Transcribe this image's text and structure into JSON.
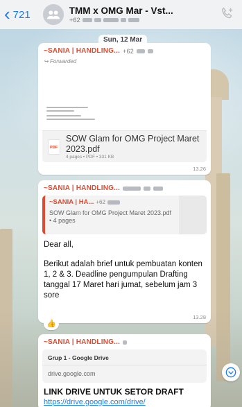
{
  "header": {
    "back_count": "721",
    "title": "TMM x OMG Mar - Vst...",
    "subtitle_prefix": "+62"
  },
  "date_label": "Sun, 12 Mar",
  "messages": [
    {
      "sender": "~SANIA | HANDLING...",
      "sender_phone": "+62",
      "forwarded": "Forwarded",
      "document": {
        "name": "SOW Glam for OMG Project Maret 2023.pdf",
        "meta": "4 pages • PDF • 331 KB",
        "type_tag": "PDF"
      },
      "time": "13.26"
    },
    {
      "sender": "~SANIA | HANDLING...",
      "quote": {
        "sender": "~SANIA | HA...",
        "sender_phone": "+62",
        "text": "SOW Glam for OMG Project Maret 2023.pdf • 4 pages"
      },
      "body": [
        "Dear all,",
        "Berikut adalah brief untuk pembuatan konten 1, 2 & 3. Deadline pengumpulan Drafting tanggal 17 Maret hari jumat, sebelum jam 3 sore"
      ],
      "time": "13.28",
      "reaction": "👍"
    },
    {
      "sender": "~SANIA | HANDLING...",
      "link_preview": {
        "title": "Grup 1 - Google Drive",
        "domain": "drive.google.com"
      },
      "text": "LINK DRIVE UNTUK SETOR DRAFT",
      "url": "https://drive.google.com/drive/"
    }
  ],
  "icons": {
    "back": "chevron-left-icon",
    "avatar": "group-avatar-icon",
    "call": "add-call-icon",
    "scroll": "chevron-down-icon"
  },
  "colors": {
    "accent": "#1a7cf2",
    "sender": "#e04a2f"
  }
}
